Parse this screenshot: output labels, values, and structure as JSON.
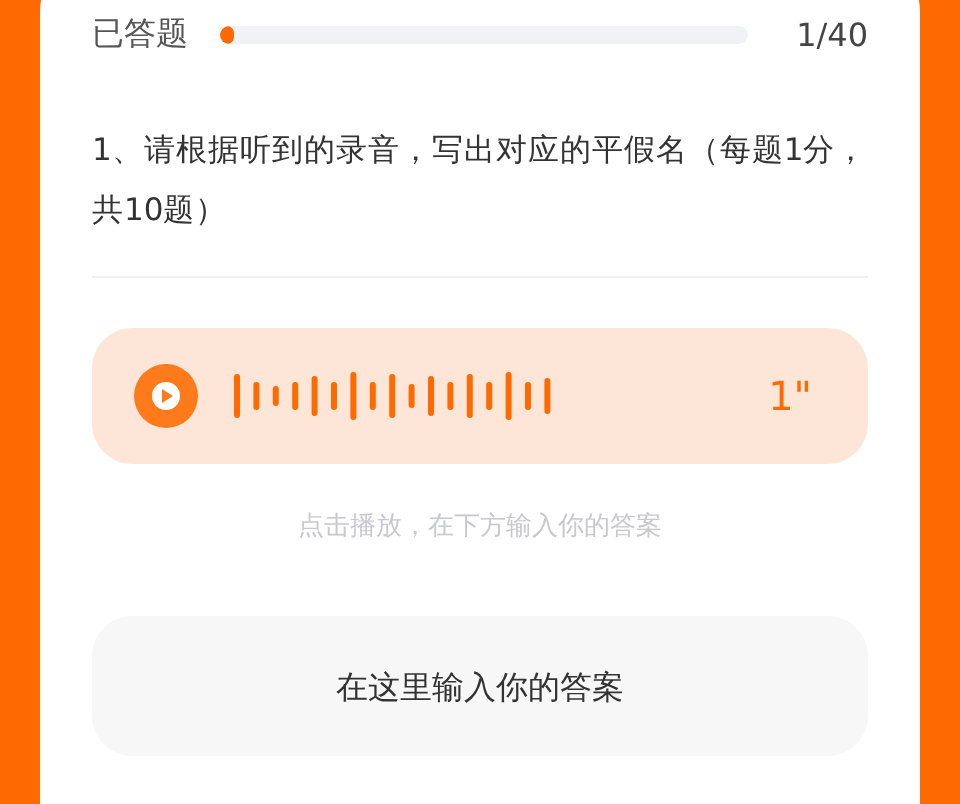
{
  "progress": {
    "label": "已答题",
    "level": 0.025,
    "count": "1/40"
  },
  "question": "1、请根据听到的录音，写出对应的平假名（每题1分，共10题）",
  "audio": {
    "duration": "1\""
  },
  "hint": "点击播放，在下方输入你的答案",
  "answer": {
    "placeholder": "在这里输入你的答案"
  }
}
